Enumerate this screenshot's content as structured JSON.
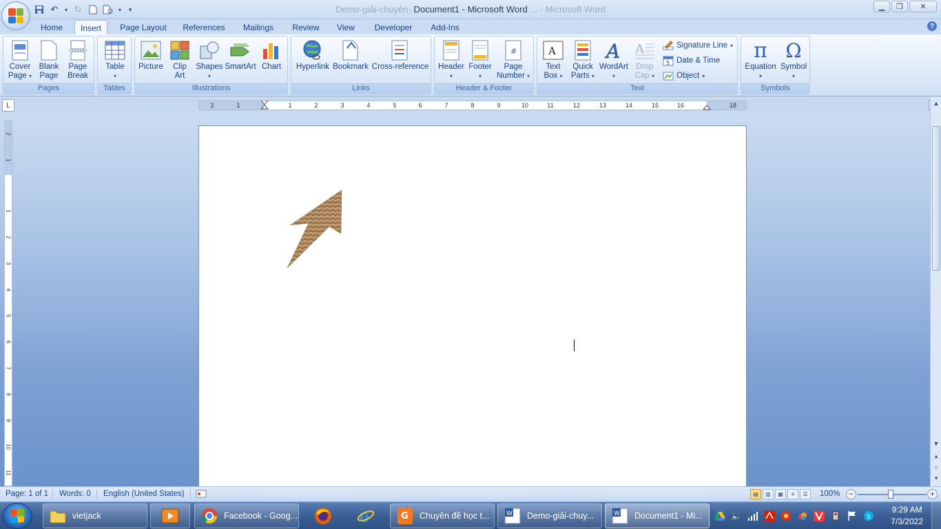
{
  "window": {
    "title_faded_left": "Demo-giải-chuyên-",
    "title_main": "Document1 - Microsoft Word",
    "title_faded_right": "... - Microsoft Word"
  },
  "ribbon_tabs": [
    "Home",
    "Insert",
    "Page Layout",
    "References",
    "Mailings",
    "Review",
    "View",
    "Developer",
    "Add-Ins"
  ],
  "active_tab": "Insert",
  "groups": {
    "pages": {
      "label": "Pages",
      "cover_page": [
        "Cover",
        "Page"
      ],
      "blank_page": [
        "Blank",
        "Page"
      ],
      "page_break": [
        "Page",
        "Break"
      ]
    },
    "tables": {
      "label": "Tables",
      "table": "Table"
    },
    "illustrations": {
      "label": "Illustrations",
      "picture": "Picture",
      "clip_art": [
        "Clip",
        "Art"
      ],
      "shapes": "Shapes",
      "smartart": "SmartArt",
      "chart": "Chart"
    },
    "links": {
      "label": "Links",
      "hyperlink": "Hyperlink",
      "bookmark": "Bookmark",
      "cross_reference": "Cross-reference"
    },
    "header_footer": {
      "label": "Header & Footer",
      "header": "Header",
      "footer": "Footer",
      "page_number": [
        "Page",
        "Number"
      ]
    },
    "text": {
      "label": "Text",
      "text_box": [
        "Text",
        "Box"
      ],
      "quick_parts": [
        "Quick",
        "Parts"
      ],
      "wordart": "WordArt",
      "drop_cap": [
        "Drop",
        "Cap"
      ],
      "signature_line": "Signature Line",
      "date_time": "Date & Time",
      "object": "Object"
    },
    "symbols": {
      "label": "Symbols",
      "equation": "Equation",
      "symbol": "Symbol"
    }
  },
  "ruler": {
    "ticks": [
      "2",
      "1",
      "1",
      "2",
      "3",
      "4",
      "5",
      "6",
      "7",
      "8",
      "9",
      "10",
      "11",
      "12",
      "13",
      "14",
      "15",
      "16",
      "18"
    ],
    "vticks": [
      "2",
      "1",
      "1",
      "2",
      "3",
      "4",
      "5",
      "6",
      "7",
      "8",
      "9",
      "10",
      "11"
    ],
    "tab_selector": "L"
  },
  "status": {
    "page": "Page: 1 of 1",
    "words": "Words: 0",
    "language": "English (United States)",
    "zoom": "100%"
  },
  "taskbar": {
    "items": [
      {
        "label": "vietjack"
      },
      {
        "label": ""
      },
      {
        "label": "Facebook - Goog..."
      },
      {
        "label": ""
      },
      {
        "label": ""
      },
      {
        "label": "Chuyên đề học t..."
      },
      {
        "label": "Demo-giải-chuy..."
      },
      {
        "label": "Document1 - Mi..."
      }
    ],
    "time": "9:29 AM",
    "date": "7/3/2022"
  },
  "colors": {
    "accent": "#15428b",
    "ribbon_bg": "#dbe8f7",
    "doc_bg": "#7ea1d3",
    "taskbar": "#3b5f95"
  }
}
